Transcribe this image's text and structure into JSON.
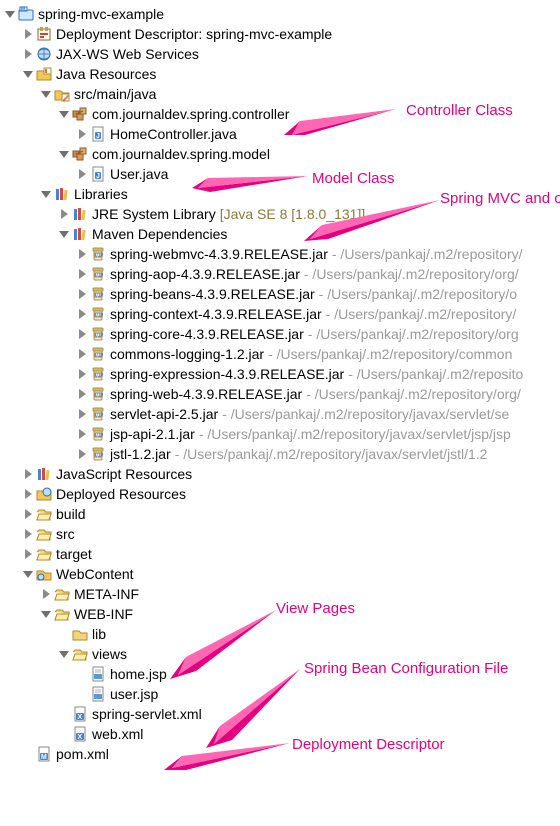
{
  "colors": {
    "annotation": "#e5007e",
    "arrow_body": "#e5007e",
    "arrow_light": "#ff66b3"
  },
  "labels": {
    "root": "spring-mvc-example",
    "dd": "Deployment Descriptor: spring-mvc-example",
    "jaxws": "JAX-WS Web Services",
    "jres": "Java Resources",
    "smj": "src/main/java",
    "pkg_ctrl": "com.journaldev.spring.controller",
    "file_home": "HomeController.java",
    "pkg_model": "com.journaldev.spring.model",
    "file_user": "User.java",
    "libs": "Libraries",
    "jre": "JRE System Library",
    "jre_decor": "[Java SE 8 [1.8.0_131]]",
    "mvn": "Maven Dependencies",
    "jars": [
      {
        "n": "spring-webmvc-4.3.9.RELEASE.jar",
        "p": " - /Users/pankaj/.m2/repository/"
      },
      {
        "n": "spring-aop-4.3.9.RELEASE.jar",
        "p": " - /Users/pankaj/.m2/repository/org/"
      },
      {
        "n": "spring-beans-4.3.9.RELEASE.jar",
        "p": " - /Users/pankaj/.m2/repository/o"
      },
      {
        "n": "spring-context-4.3.9.RELEASE.jar",
        "p": " - /Users/pankaj/.m2/repository/"
      },
      {
        "n": "spring-core-4.3.9.RELEASE.jar",
        "p": " - /Users/pankaj/.m2/repository/org"
      },
      {
        "n": "commons-logging-1.2.jar",
        "p": " - /Users/pankaj/.m2/repository/common"
      },
      {
        "n": "spring-expression-4.3.9.RELEASE.jar",
        "p": " - /Users/pankaj/.m2/reposito"
      },
      {
        "n": "spring-web-4.3.9.RELEASE.jar",
        "p": " - /Users/pankaj/.m2/repository/org/"
      },
      {
        "n": "servlet-api-2.5.jar",
        "p": " - /Users/pankaj/.m2/repository/javax/servlet/se"
      },
      {
        "n": "jsp-api-2.1.jar",
        "p": " - /Users/pankaj/.m2/repository/javax/servlet/jsp/jsp"
      },
      {
        "n": "jstl-1.2.jar",
        "p": " - /Users/pankaj/.m2/repository/javax/servlet/jstl/1.2"
      }
    ],
    "jsres": "JavaScript Resources",
    "dep": "Deployed Resources",
    "build": "build",
    "src": "src",
    "target": "target",
    "webc": "WebContent",
    "meta": "META-INF",
    "webinf": "WEB-INF",
    "lib": "lib",
    "views": "views",
    "home_jsp": "home.jsp",
    "user_jsp": "user.jsp",
    "sservlet": "spring-servlet.xml",
    "webxml": "web.xml",
    "pom": "pom.xml"
  },
  "annotations": {
    "controller": "Controller Class",
    "model": "Model Class",
    "deps": "Spring MVC and other dependencies",
    "views": "View Pages",
    "bean": "Spring Bean Configuration File",
    "dd": "Deployment Descriptor"
  }
}
